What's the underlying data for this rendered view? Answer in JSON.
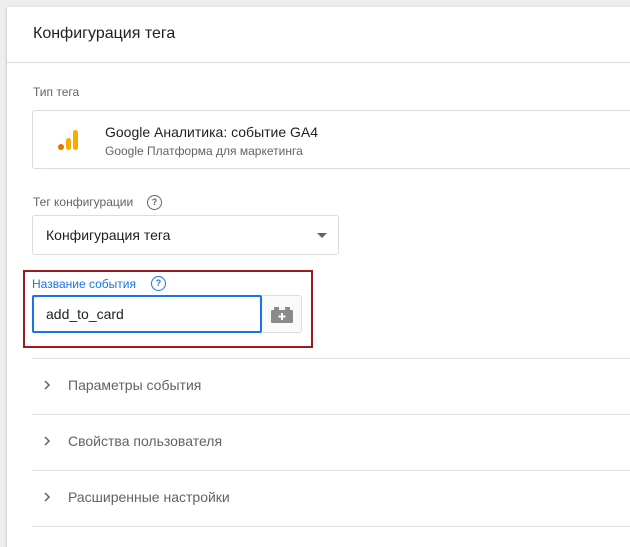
{
  "panel": {
    "title": "Конфигурация тега"
  },
  "tag_type": {
    "label": "Тип тега",
    "name": "Google Аналитика: событие GA4",
    "subtitle": "Google Платформа для маркетинга",
    "icon": "google-analytics-icon",
    "icon_colors": [
      "#e37400",
      "#f9ab00",
      "#f9ab00"
    ]
  },
  "config_tag": {
    "label": "Тег конфигурации",
    "help_glyph": "?",
    "selected": "Конфигурация тега"
  },
  "event_name": {
    "label": "Название события",
    "help_glyph": "?",
    "value": "add_to_card",
    "variable_icon": "variable-picker-icon"
  },
  "sections": [
    {
      "label": "Параметры события"
    },
    {
      "label": "Свойства пользователя"
    },
    {
      "label": "Расширенные настройки"
    }
  ],
  "colors": {
    "accent": "#1a73e8",
    "highlight": "#9c1c1c"
  }
}
